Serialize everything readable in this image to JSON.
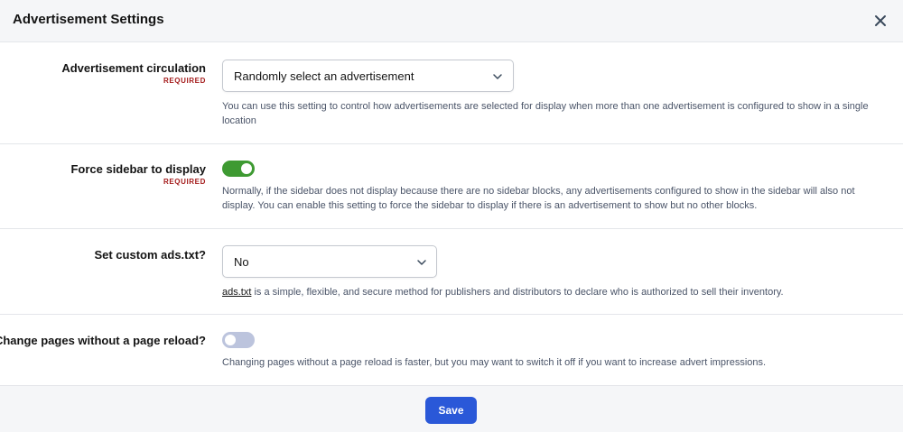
{
  "dialog": {
    "title": "Advertisement Settings",
    "close_icon": "close-icon"
  },
  "settings": [
    {
      "label": "Advertisement circulation",
      "required": "REQUIRED",
      "control": "select",
      "value": "Randomly select an advertisement",
      "help": "You can use this setting to control how advertisements are selected for display when more than one advertisement is configured to show in a single location"
    },
    {
      "label": "Force sidebar to display",
      "required": "REQUIRED",
      "control": "toggle",
      "checked": true,
      "help": "Normally, if the sidebar does not display because there are no sidebar blocks, any advertisements configured to show in the sidebar will also not display. You can enable this setting to force the sidebar to display if there is an advertisement to show but no other blocks."
    },
    {
      "label": "Set custom ads.txt?",
      "control": "select",
      "value": "No",
      "help_link": "ads.txt",
      "help": " is a simple, flexible, and secure method for publishers and distributors to declare who is authorized to sell their inventory."
    },
    {
      "label": "Change pages without a page reload?",
      "control": "toggle",
      "checked": false,
      "help": "Changing pages without a page reload is faster, but you may want to switch it off if you want to increase advert impressions."
    }
  ],
  "footer": {
    "save_label": "Save"
  },
  "colors": {
    "toggle_on": "#3e9a32",
    "toggle_off": "#bcc4dd",
    "primary_button": "#2a58d8",
    "required_text": "#a41b1b"
  }
}
